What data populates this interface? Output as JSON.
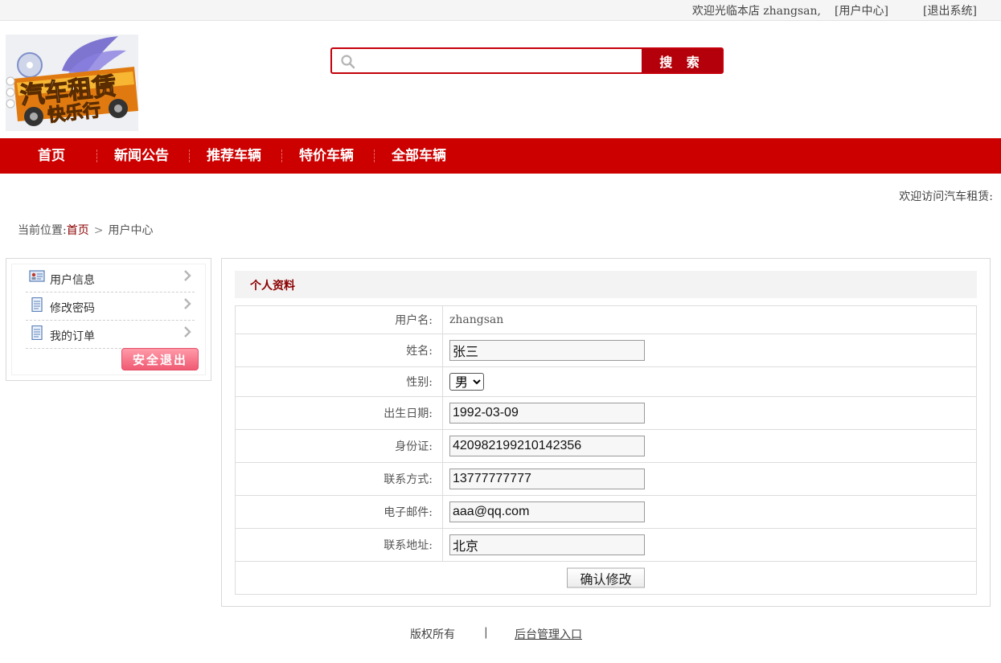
{
  "topbar": {
    "welcome": "欢迎光临本店 zhangsan,",
    "user_center": "[用户中心]",
    "logout": "[退出系统]"
  },
  "logo": {
    "alt": "汽车租赁 快乐行"
  },
  "search": {
    "placeholder": "",
    "button": "搜 索"
  },
  "nav": {
    "items": [
      "首页",
      "新闻公告",
      "推荐车辆",
      "特价车辆",
      "全部车辆"
    ]
  },
  "marquee": "欢迎访问汽车租赁:",
  "breadcrumb": {
    "prefix": "当前位置:",
    "home": "首页",
    "arrow": ">",
    "current": "用户中心"
  },
  "sidebar": {
    "items": [
      {
        "label": "用户信息",
        "icon": "id-card-icon"
      },
      {
        "label": "修改密码",
        "icon": "document-icon"
      },
      {
        "label": "我的订单",
        "icon": "document-icon"
      }
    ],
    "logout": "安全退出"
  },
  "profile": {
    "title": "个人资料",
    "username_label": "用户名:",
    "username": "zhangsan",
    "name_label": "姓名:",
    "name": "张三",
    "gender_label": "性别:",
    "gender": "男",
    "birth_label": "出生日期:",
    "birth": "1992-03-09",
    "idcard_label": "身份证:",
    "idcard": "420982199210142356",
    "phone_label": "联系方式:",
    "phone": "13777777777",
    "email_label": "电子邮件:",
    "email": "aaa@qq.com",
    "address_label": "联系地址:",
    "address": "北京",
    "submit": "确认修改"
  },
  "footer": {
    "copyright": "版权所有",
    "divider": "|",
    "admin": "后台管理入口"
  },
  "colors": {
    "brand_red": "#cd0000",
    "search_red": "#c4000b",
    "link_dark_red": "#8b0000",
    "logout_pink": "#f05a72"
  }
}
